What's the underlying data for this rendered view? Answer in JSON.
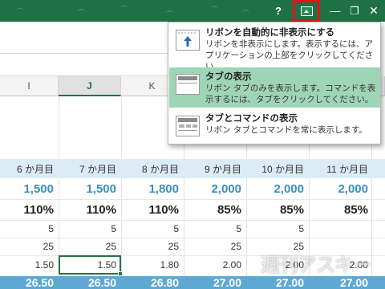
{
  "titlebar": {
    "help_label": "?",
    "minimize_label": "—",
    "restore_label": "❐",
    "close_label": "✕",
    "color": "#1e7145",
    "highlight_color": "#e8101a"
  },
  "columns": [
    "I",
    "J",
    "K"
  ],
  "active_column": "J",
  "months": [
    "6 か月目",
    "7 か月目",
    "8 か月目",
    "9 か月目",
    "10 か月目",
    "11 か月目"
  ],
  "rows": {
    "blue": [
      "1,500",
      "1,500",
      "1,800",
      "2,000",
      "2,000",
      "2,000"
    ],
    "percent": [
      "110%",
      "110%",
      "110%",
      "85%",
      "85%",
      "85%"
    ],
    "fives": [
      "5",
      "5",
      "5",
      "5",
      "5",
      ""
    ],
    "twentyfives": [
      "25",
      "25",
      "25",
      "25",
      "25",
      ""
    ],
    "decimals": [
      "1.50",
      "1.50",
      "1.80",
      "2.00",
      "2.00",
      "2.00"
    ],
    "bottom": [
      "26.50",
      "26.50",
      "26.80",
      "27.00",
      "27.00",
      "27.00"
    ]
  },
  "menu": {
    "items": [
      {
        "title": "リボンを自動的に非表示にする",
        "description": "リボンを非表示にします。表示するには、アプリケーションの上部をクリックしてください。",
        "icon": "auto-hide-arrow-icon"
      },
      {
        "title": "タブの表示",
        "description": "リボン タブのみを表示します。コマンドを表示するには、タブをクリックしてください。",
        "icon": "show-tabs-icon"
      },
      {
        "title": "タブとコマンドの表示",
        "description": "リボン タブとコマンドを常に表示します。",
        "icon": "show-tabs-commands-icon"
      }
    ],
    "selected_index": 1,
    "selected_color": "#9fd5b7"
  },
  "watermark": "週刊アスキー"
}
